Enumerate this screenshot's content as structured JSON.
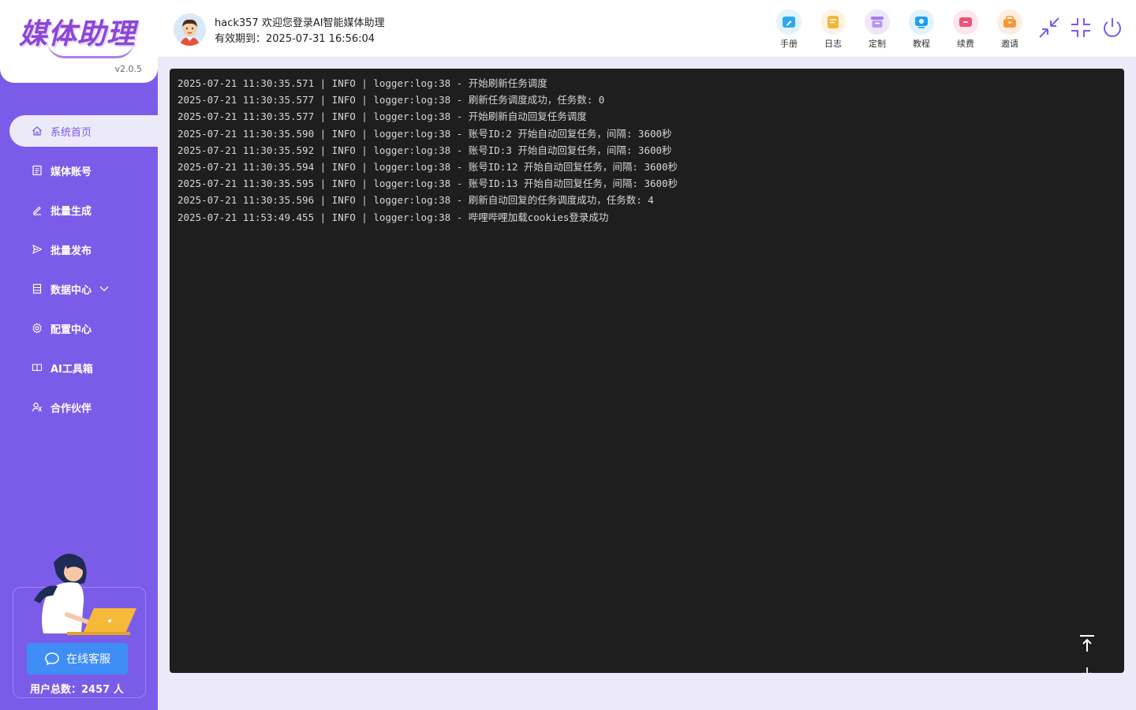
{
  "app": {
    "logo_text": "媒体助理",
    "version": "v2.0.5"
  },
  "sidebar": {
    "items": [
      {
        "label": "系统首页",
        "icon": "home-icon",
        "active": true
      },
      {
        "label": "媒体账号",
        "icon": "account-list-icon"
      },
      {
        "label": "批量生成",
        "icon": "edit-pen-icon"
      },
      {
        "label": "批量发布",
        "icon": "send-icon"
      },
      {
        "label": "数据中心",
        "icon": "data-doc-icon",
        "has_submenu": true
      },
      {
        "label": "配置中心",
        "icon": "gear-icon"
      },
      {
        "label": "AI工具箱",
        "icon": "book-icon"
      },
      {
        "label": "合作伙伴",
        "icon": "partner-icon"
      }
    ],
    "support_button": "在线客服",
    "user_total": "用户总数：2457 人"
  },
  "header": {
    "greeting": "hack357 欢迎您登录AI智能媒体助理",
    "expiry": "有效期到：2025-07-31 16:56:04",
    "tools": [
      {
        "label": "手册",
        "icon": "manual-icon",
        "color": "#2aa8f0",
        "bg": "#e3f3fd"
      },
      {
        "label": "日志",
        "icon": "log-icon",
        "color": "#f4b53b",
        "bg": "#fdf3e0"
      },
      {
        "label": "定制",
        "icon": "custom-icon",
        "color": "#a27bea",
        "bg": "#efe8fb"
      },
      {
        "label": "教程",
        "icon": "tutorial-icon",
        "color": "#1e9ef0",
        "bg": "#e2f2fd"
      },
      {
        "label": "续费",
        "icon": "renew-icon",
        "color": "#f0507a",
        "bg": "#fde6ec"
      },
      {
        "label": "邀请",
        "icon": "invite-icon",
        "color": "#f59a3a",
        "bg": "#fdeede"
      }
    ]
  },
  "log": {
    "lines": [
      "2025-07-21 11:30:35.571 | INFO | logger:log:38 - 开始刷新任务调度",
      "2025-07-21 11:30:35.577 | INFO | logger:log:38 - 刷新任务调度成功，任务数: 0",
      "2025-07-21 11:30:35.577 | INFO | logger:log:38 - 开始刷新自动回复任务调度",
      "2025-07-21 11:30:35.590 | INFO | logger:log:38 - 账号ID:2 开始自动回复任务，间隔: 3600秒",
      "2025-07-21 11:30:35.592 | INFO | logger:log:38 - 账号ID:3 开始自动回复任务，间隔: 3600秒",
      "2025-07-21 11:30:35.594 | INFO | logger:log:38 - 账号ID:12 开始自动回复任务，间隔: 3600秒",
      "2025-07-21 11:30:35.595 | INFO | logger:log:38 - 账号ID:13 开始自动回复任务，间隔: 3600秒",
      "2025-07-21 11:30:35.596 | INFO | logger:log:38 - 刷新自动回复的任务调度成功，任务数: 4",
      "2025-07-21 11:53:49.455 | INFO | logger:log:38 - 哔哩哔哩加载cookies登录成功"
    ]
  },
  "colors": {
    "sidebar": "#7b5ce8",
    "page_bg": "#eceaf8",
    "log_bg": "#1e1e1e",
    "accent_blue": "#3f8ef6"
  }
}
